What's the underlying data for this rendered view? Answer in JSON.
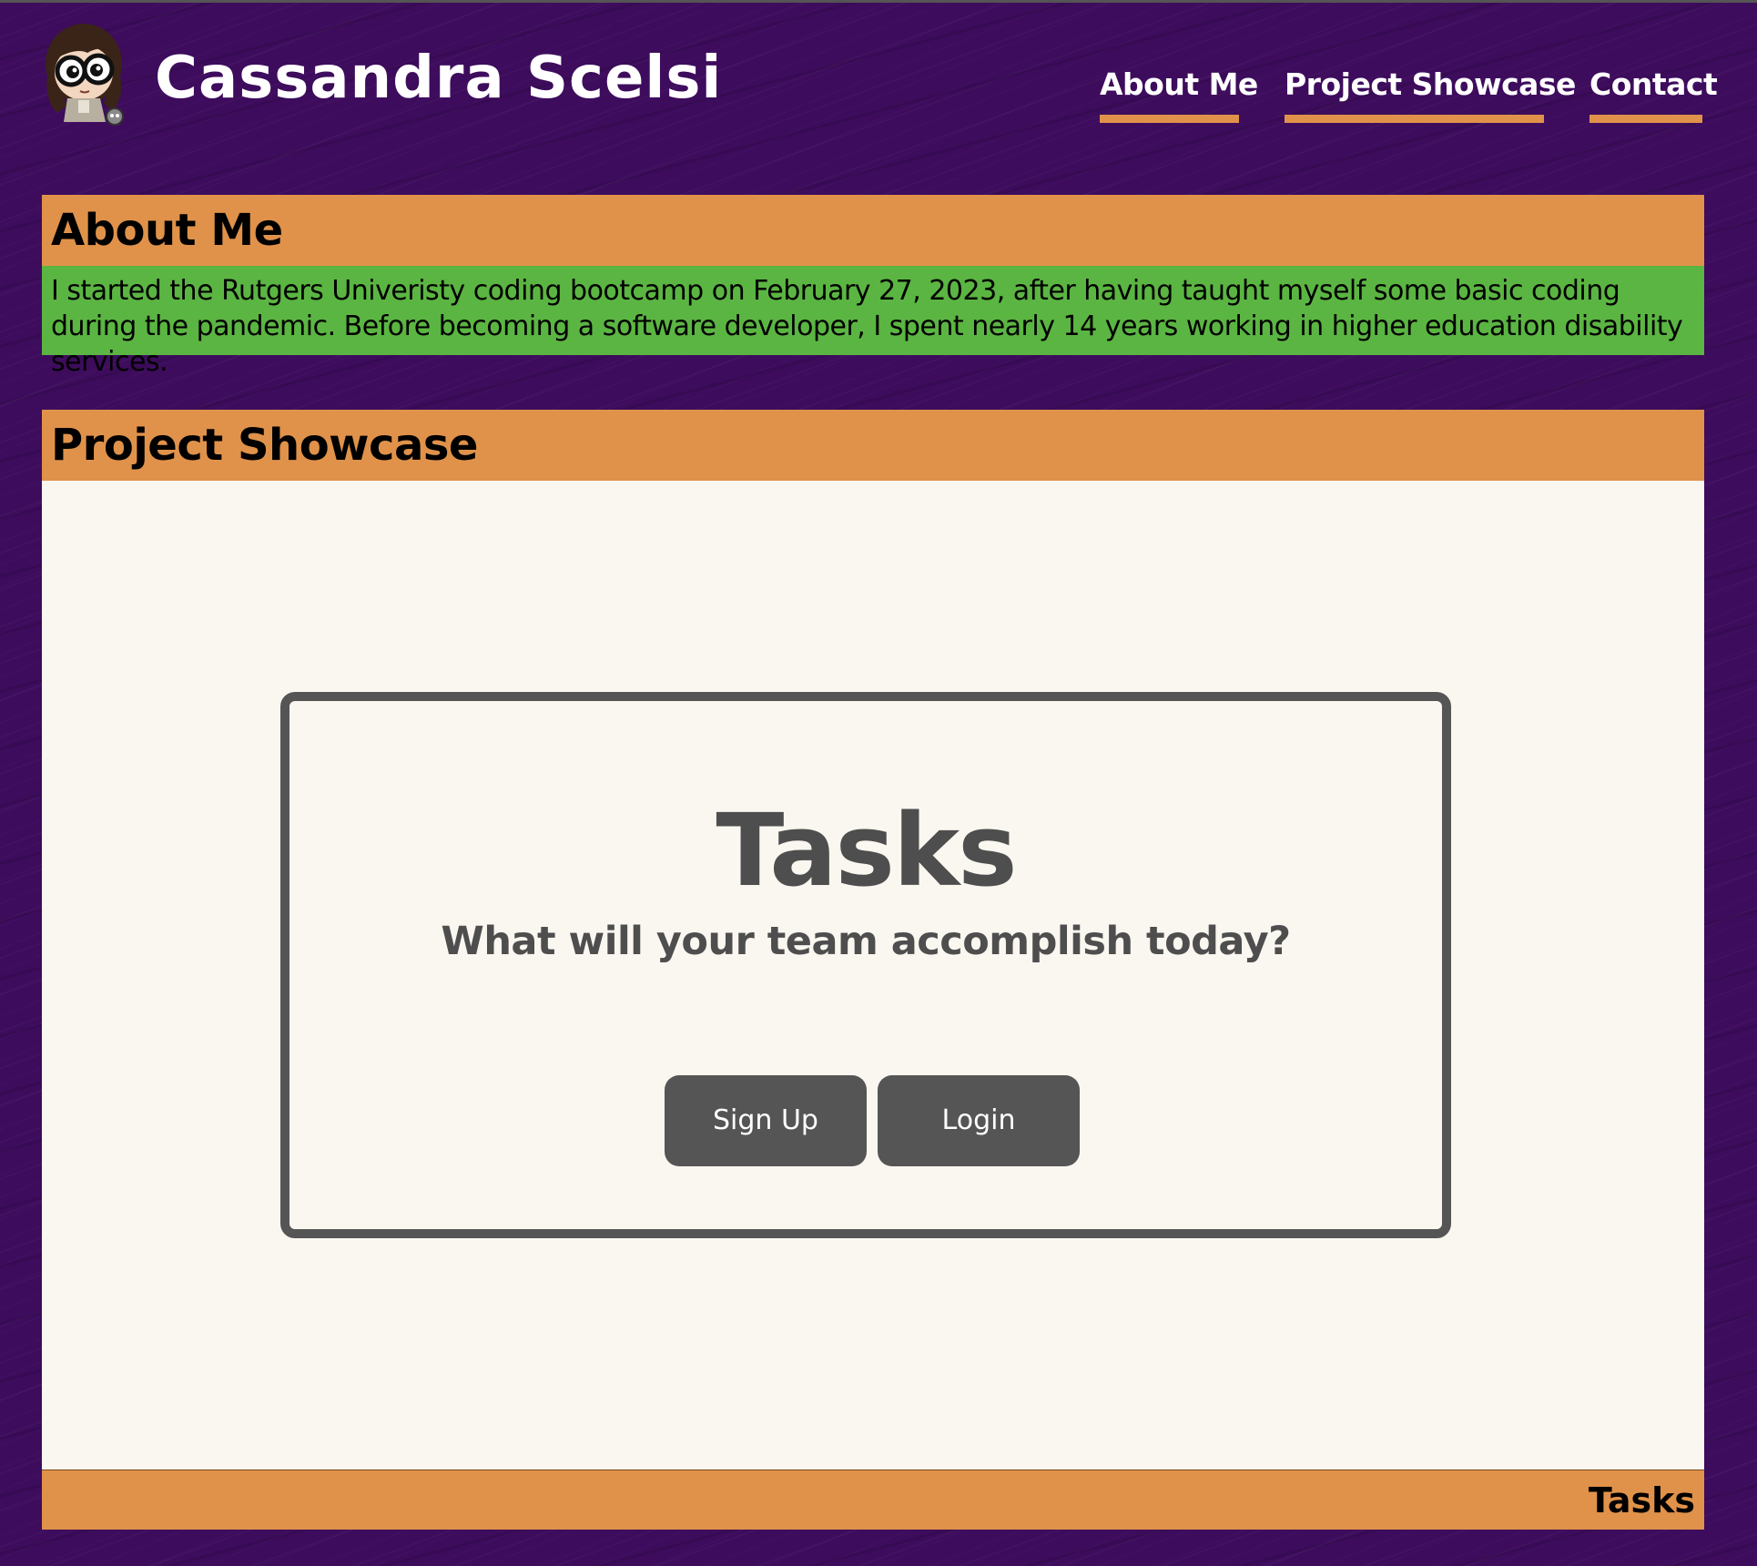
{
  "header": {
    "site_title": "Cassandra Scelsi",
    "avatar_icon": "cartoon-avatar-icon",
    "nav": [
      "About Me",
      "Project Showcase",
      "Contact"
    ]
  },
  "about": {
    "heading": "About Me",
    "text": "I started the Rutgers Univeristy coding bootcamp on February 27, 2023, after having taught myself some basic coding during the pandemic. Before becoming a software developer, I spent nearly 14 years working in higher education disability services."
  },
  "showcase": {
    "heading": "Project Showcase",
    "project": {
      "title": "Tasks",
      "subtitle": "What will your team accomplish today?",
      "signup_label": "Sign Up",
      "login_label": "Login"
    },
    "footer_label": "Tasks"
  },
  "colors": {
    "background": "#3d0c5c",
    "accent_orange": "#e0924a",
    "about_green": "#5bb542",
    "card_gray": "#555555",
    "panel_cream": "#faf7f0"
  }
}
